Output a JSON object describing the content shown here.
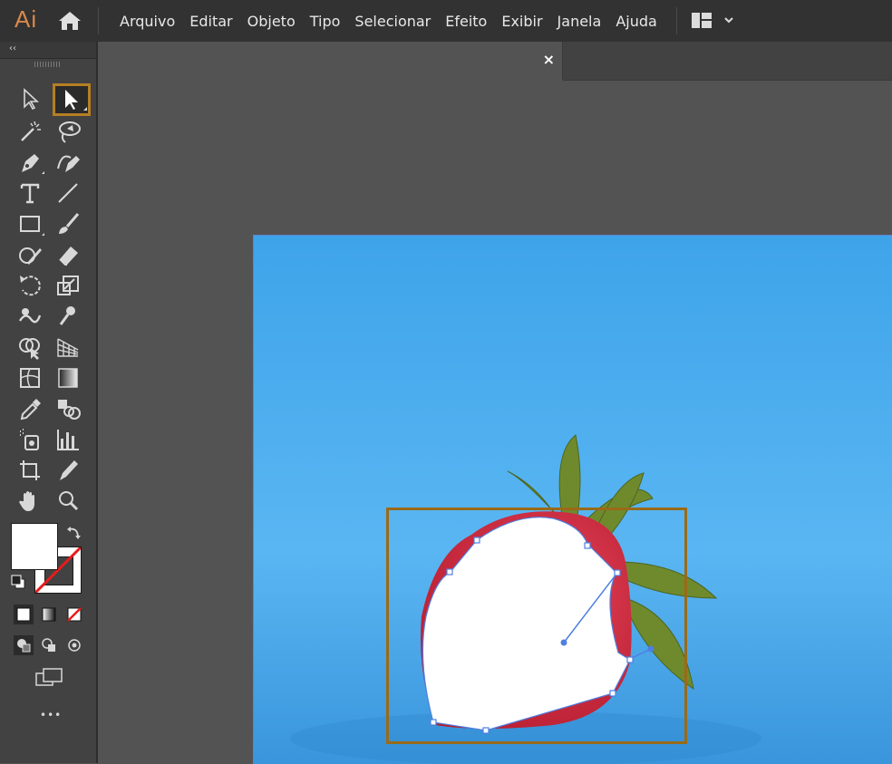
{
  "app": {
    "logo_text": "Ai",
    "brand_color": "#d9884a",
    "accent_color": "#b57f23"
  },
  "menubar": {
    "home_icon": "home-icon",
    "items": [
      "Arquivo",
      "Editar",
      "Objeto",
      "Tipo",
      "Selecionar",
      "Efeito",
      "Exibir",
      "Janela",
      "Ajuda"
    ],
    "workspace_icon": "workspace-layout-icon"
  },
  "document_tab": {
    "close_label": "×"
  },
  "toolbar": {
    "collapse_label": "‹‹",
    "more_label": "•••",
    "tools": [
      [
        "selection-tool",
        "direct-selection-tool"
      ],
      [
        "magic-wand-tool",
        "lasso-tool"
      ],
      [
        "pen-tool",
        "curvature-tool"
      ],
      [
        "type-tool",
        "line-segment-tool"
      ],
      [
        "rectangle-tool",
        "paintbrush-tool"
      ],
      [
        "shaper-tool",
        "eraser-tool"
      ],
      [
        "rotate-tool",
        "scale-tool"
      ],
      [
        "warp-tool",
        "puppet-warp-tool"
      ],
      [
        "shape-builder-tool",
        "perspective-grid-tool"
      ],
      [
        "mesh-tool",
        "gradient-tool"
      ],
      [
        "eyedropper-tool",
        "blend-tool"
      ],
      [
        "symbol-sprayer-tool",
        "column-graph-tool"
      ],
      [
        "artboard-tool",
        "slice-tool"
      ],
      [
        "hand-tool",
        "zoom-tool"
      ]
    ],
    "active_tool": "direct-selection-tool",
    "fill_color": "#ffffff",
    "stroke": "none"
  },
  "canvas": {
    "background_color": "#4aa8ec",
    "selection_color": "#9a6a18",
    "path_color": "#4f7fe0"
  }
}
